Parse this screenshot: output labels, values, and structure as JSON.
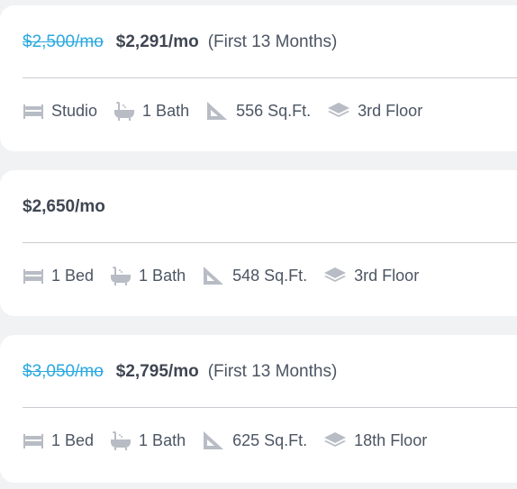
{
  "listings": [
    {
      "old_price": "$2,500/mo",
      "price": "$2,291/mo",
      "promo": "(First 13 Months)",
      "beds": "Studio",
      "baths": "1 Bath",
      "area": "556 Sq.Ft.",
      "floor": "3rd Floor"
    },
    {
      "old_price": "",
      "price": "$2,650/mo",
      "promo": "",
      "beds": "1 Bed",
      "baths": "1 Bath",
      "area": "548 Sq.Ft.",
      "floor": "3rd Floor"
    },
    {
      "old_price": "$3,050/mo",
      "price": "$2,795/mo",
      "promo": "(First 13 Months)",
      "beds": "1 Bed",
      "baths": "1 Bath",
      "area": "625 Sq.Ft.",
      "floor": "18th Floor"
    }
  ],
  "colors": {
    "old_price": "#29a8e0",
    "price": "#3f4652",
    "icon": "#b8bcc4",
    "divider": "#c9ccd1"
  },
  "icons": [
    "bed-icon",
    "bathtub-icon",
    "ruler-triangle-icon",
    "floor-layers-icon"
  ]
}
